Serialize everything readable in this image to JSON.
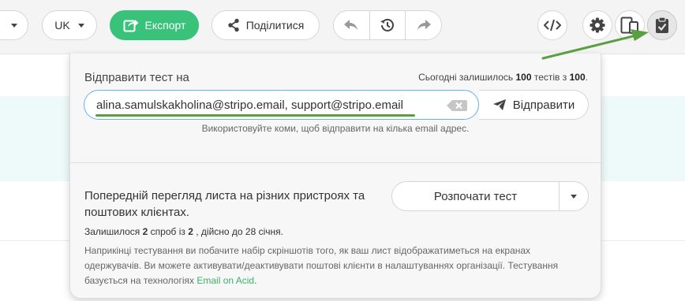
{
  "toolbar": {
    "language": "UK",
    "export_label": "Експорт",
    "share_label": "Поділитися",
    "icons": {
      "export": "export-icon",
      "share": "share-icon",
      "undo": "undo-icon",
      "history": "history-icon",
      "redo": "redo-icon",
      "code": "code-icon",
      "settings": "gear-icon",
      "devices": "device-preview-icon",
      "test": "clipboard-check-icon"
    }
  },
  "panel": {
    "send_title": "Відправити тест на",
    "quota": {
      "prefix": "Сьогодні залишилось",
      "remaining": "100",
      "middle": "тестів з",
      "total": "100",
      "suffix": "."
    },
    "email_value": "alina.samulskakholina@stripo.email, support@stripo.email",
    "send_button": "Відправити",
    "hint": "Використовуйте коми, щоб відправити на кілька email адрес.",
    "preview_title": "Попередній перегляд листа на різних пристроях та поштових клієнтах.",
    "start_button": "Розпочати тест",
    "attempts": {
      "prefix": "Залишилося",
      "left": "2",
      "middle": "спроб із",
      "total": "2",
      "suffix": ", дійсно до 28 січня."
    },
    "info_text": "Наприкінці тестування ви побачите набір скріншотів того, як ваш лист відображатиметься на екранах одержувачів. Ви можете активувати/деактивувати поштові клієнти в налаштуваннях організації. Тестування базується на технологіях",
    "info_link": "Email on Acid",
    "info_end": "."
  },
  "colors": {
    "accent_green": "#39c27a",
    "annotation_green": "#5aa040",
    "input_focus_blue": "#66b4e8"
  }
}
